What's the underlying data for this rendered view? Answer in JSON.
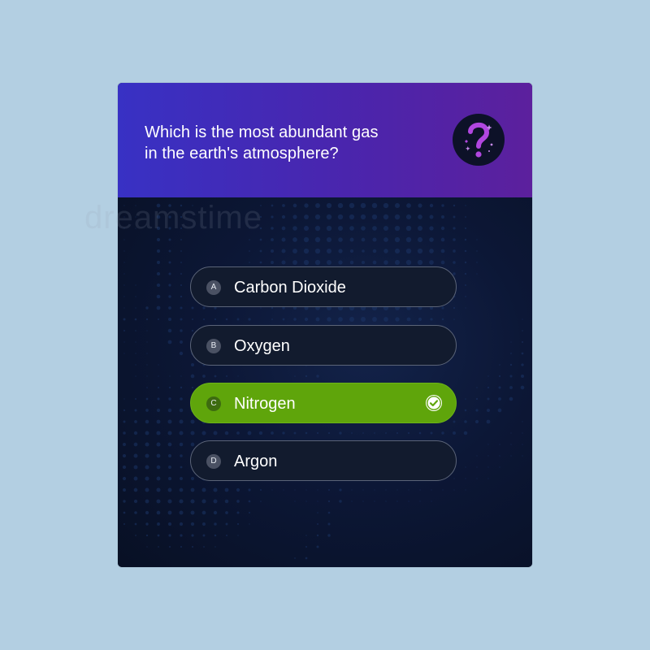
{
  "quiz": {
    "question": "Which is the most abundant gas\nin the earth's atmosphere?",
    "badge_icon": "question-mark-icon",
    "options": [
      {
        "letter": "A",
        "label": "Carbon Dioxide",
        "correct": false
      },
      {
        "letter": "B",
        "label": "Oxygen",
        "correct": false
      },
      {
        "letter": "C",
        "label": "Nitrogen",
        "correct": true
      },
      {
        "letter": "D",
        "label": "Argon",
        "correct": false
      }
    ],
    "correct_icon": "check-circle-icon"
  },
  "watermark": "dreamstime",
  "colors": {
    "page_background": "#b3cfe2",
    "header_gradient_start": "#3831c4",
    "header_gradient_end": "#5c209d",
    "body_background": "#0b1430",
    "option_background": "#121b2e",
    "correct_background": "#5fa50b",
    "badge_accent": "#b146e0"
  }
}
